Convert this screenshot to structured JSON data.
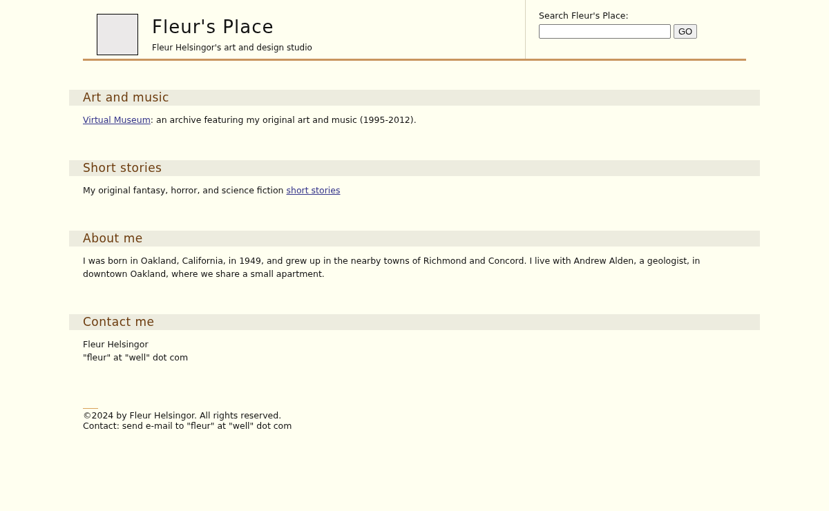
{
  "header": {
    "title": "Fleur's Place",
    "subtitle": "Fleur Helsingor's art and design studio"
  },
  "search": {
    "label": "Search Fleur's Place:",
    "button": "GO"
  },
  "sections": [
    {
      "heading": "Art and music",
      "paragraphs": [
        [
          {
            "kind": "link",
            "text": "Virtual Museum"
          },
          {
            "kind": "text",
            "text": ": an archive featuring my original art and music (1995-2012)."
          }
        ]
      ]
    },
    {
      "heading": "Short stories",
      "paragraphs": [
        [
          {
            "kind": "text",
            "text": "My original fantasy, horror, and science fiction "
          },
          {
            "kind": "link",
            "text": "short stories"
          }
        ]
      ]
    },
    {
      "heading": "About me",
      "paragraphs": [
        [
          {
            "kind": "text",
            "text": "I was born in Oakland, California, in 1949, and grew up in the nearby towns of Richmond and Concord. I live with Andrew Alden, a geologist, in downtown Oakland, where we share a small apartment."
          }
        ]
      ]
    },
    {
      "heading": "Contact me",
      "paragraphs": [
        [
          {
            "kind": "text",
            "text": "Fleur Helsingor"
          }
        ],
        [
          {
            "kind": "text",
            "text": "\"fleur\" at \"well\" dot com"
          }
        ]
      ]
    }
  ],
  "footer": [
    "©2024 by Fleur Helsingor. All rights reserved.",
    "Contact: send e-mail to \"fleur\" at \"well\" dot com"
  ]
}
